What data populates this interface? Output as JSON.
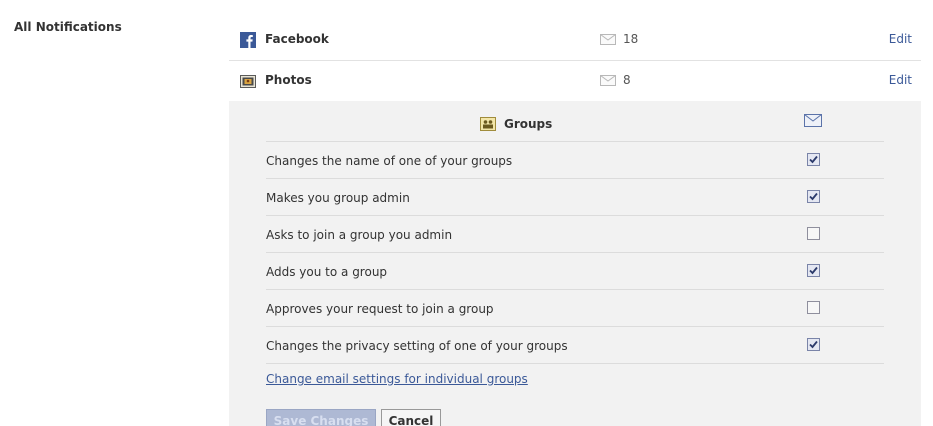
{
  "section": {
    "label": "All Notifications"
  },
  "apps": [
    {
      "name": "Facebook",
      "count": "18",
      "edit": "Edit"
    },
    {
      "name": "Photos",
      "count": "8",
      "edit": "Edit"
    }
  ],
  "groups_panel": {
    "title": "Groups",
    "options": [
      {
        "label": "Changes the name of one of your groups",
        "checked": true
      },
      {
        "label": "Makes you group admin",
        "checked": true
      },
      {
        "label": "Asks to join a group you admin",
        "checked": false
      },
      {
        "label": "Adds you to a group",
        "checked": true
      },
      {
        "label": "Approves your request to join a group",
        "checked": false
      },
      {
        "label": "Changes the privacy setting of one of your groups",
        "checked": true
      }
    ],
    "link": "Change email settings for individual groups",
    "save_label": "Save Changes",
    "cancel_label": "Cancel"
  },
  "colors": {
    "link": "#3b5998",
    "panel_bg": "#f2f2f2",
    "save_bg": "#aeb9d4"
  },
  "icons": {
    "facebook": "facebook-icon",
    "photos": "photos-icon",
    "groups": "groups-icon",
    "mail": "mail-icon",
    "checkmark": "checkmark-icon"
  }
}
